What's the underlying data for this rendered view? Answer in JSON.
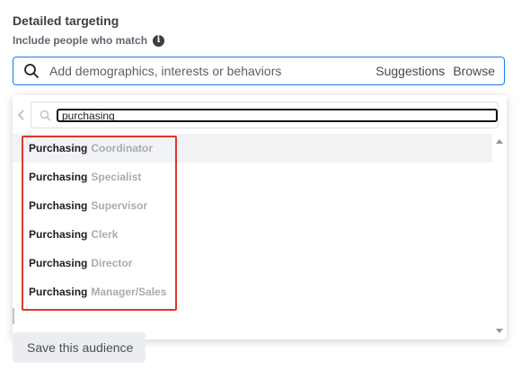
{
  "section": {
    "title": "Detailed targeting",
    "subtitle": "Include people who match",
    "info_icon": "info-icon"
  },
  "search": {
    "placeholder": "Add demographics, interests or behaviors",
    "suggestions_label": "Suggestions",
    "browse_label": "Browse"
  },
  "dropdown": {
    "query": "purchasing",
    "results": [
      {
        "match": "Purchasing",
        "rest": "Coordinator"
      },
      {
        "match": "Purchasing",
        "rest": "Specialist"
      },
      {
        "match": "Purchasing",
        "rest": "Supervisor"
      },
      {
        "match": "Purchasing",
        "rest": "Clerk"
      },
      {
        "match": "Purchasing",
        "rest": "Director"
      },
      {
        "match": "Purchasing",
        "rest": "Manager/Sales"
      }
    ]
  },
  "footer": {
    "save_label": "Save this audience"
  },
  "colors": {
    "accent": "#1877f2",
    "highlight": "#e0352b",
    "muted_text": "#a8acb2"
  }
}
